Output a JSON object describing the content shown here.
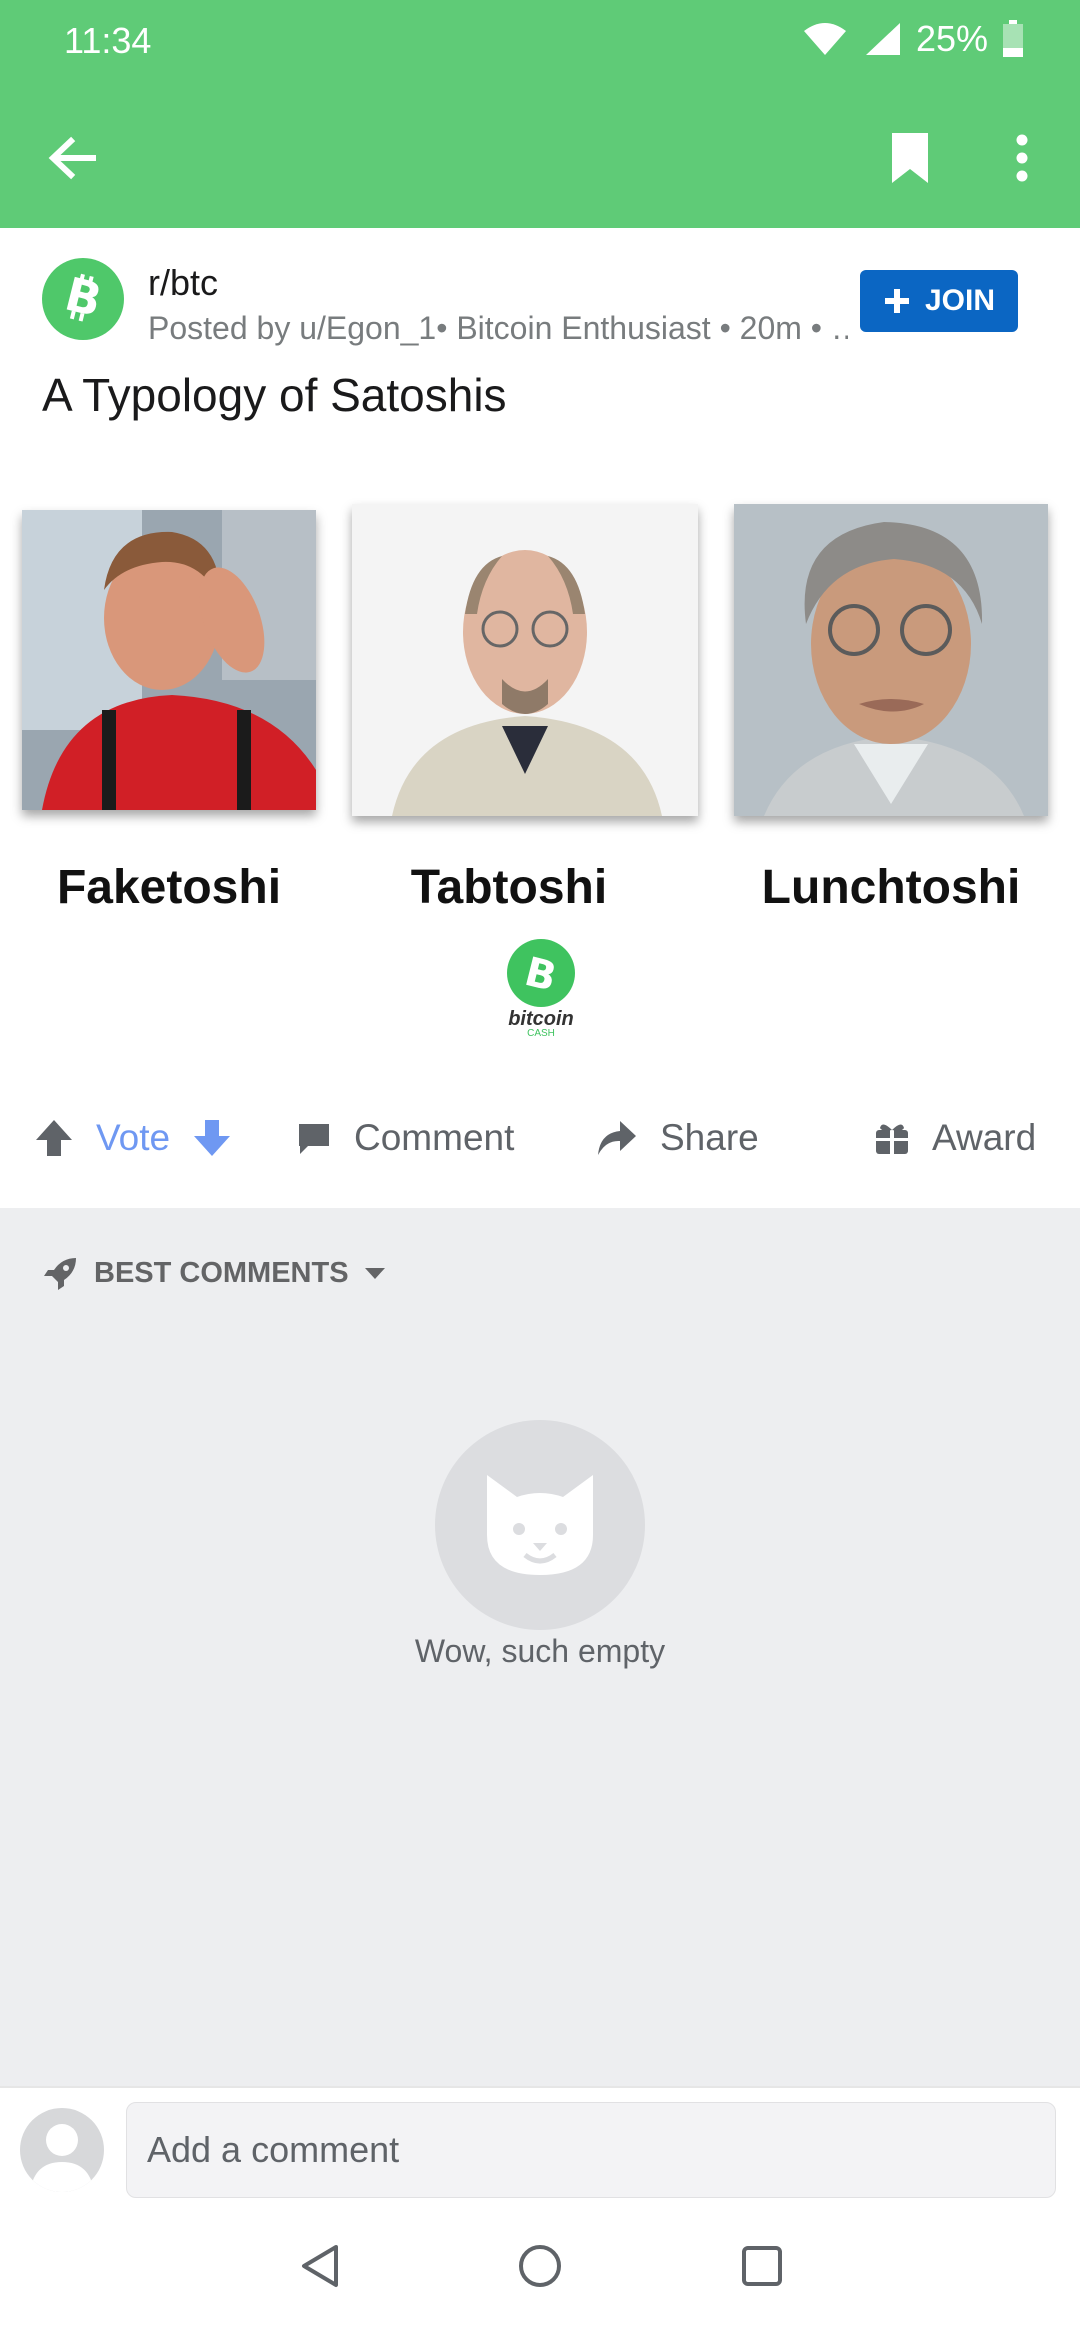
{
  "status_bar": {
    "time": "11:34",
    "battery": "25%"
  },
  "app_bar": {
    "back_icon": "arrow-left-icon",
    "bookmark_icon": "bookmark-icon",
    "menu_icon": "more-vert-icon"
  },
  "post": {
    "subreddit": "r/btc",
    "meta": "Posted by u/Egon_1• Bitcoin Enthusiast • 20m • …",
    "join_label": "JOIN",
    "title": "A Typology of Satoshis"
  },
  "image": {
    "captions": [
      "Faketoshi",
      "Tabtoshi",
      "Lunchtoshi"
    ],
    "logo_text_top": "bitcoin",
    "logo_text_bottom": "CASH"
  },
  "actions": {
    "vote": "Vote",
    "comment": "Comment",
    "share": "Share",
    "award": "Award"
  },
  "comments": {
    "sort_label": "BEST COMMENTS",
    "empty_text": "Wow, such empty"
  },
  "comment_bar": {
    "placeholder": "Add a comment"
  },
  "colors": {
    "green": "#5fcb77",
    "join_blue": "#0b66c3",
    "vote_blue": "#6f98f2"
  }
}
